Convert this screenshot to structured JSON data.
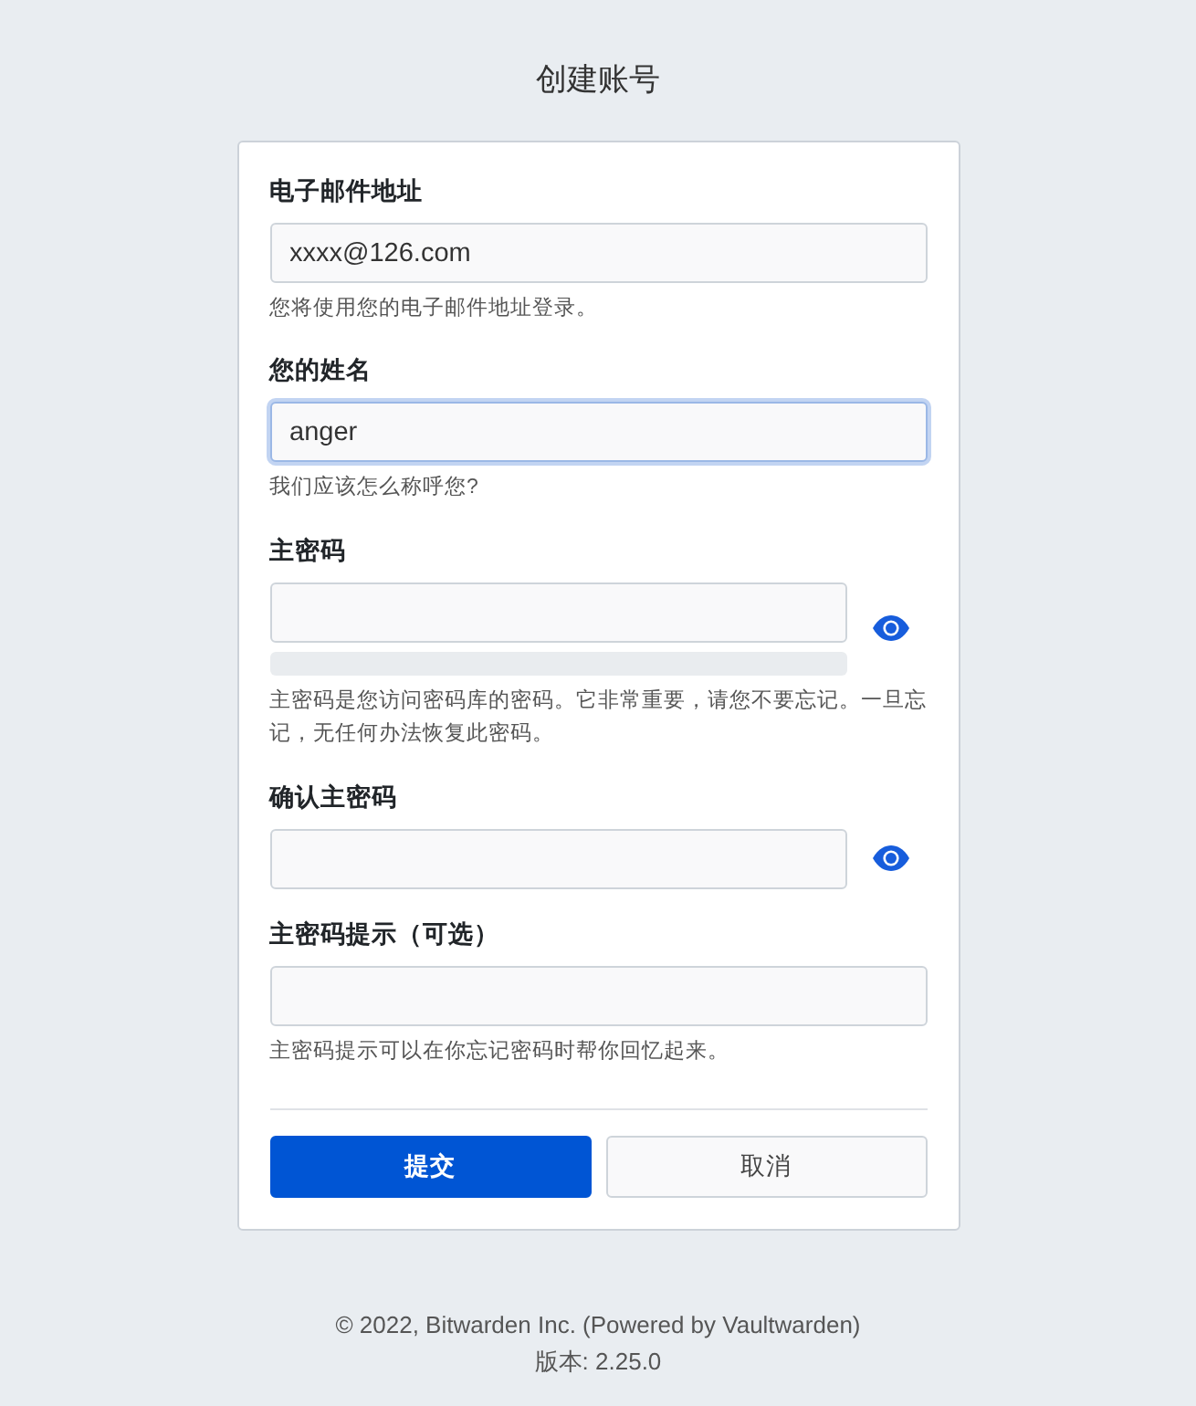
{
  "title": "创建账号",
  "fields": [
    {
      "kind": "text",
      "label": "电子邮件地址",
      "value": "xxxx@126.com",
      "focused": false,
      "help": "您将使用您的电子邮件地址登录。"
    },
    {
      "kind": "text",
      "label": "您的姓名",
      "value": "anger",
      "focused": true,
      "help": "我们应该怎么称呼您?"
    },
    {
      "kind": "password",
      "label": "主密码",
      "focused": false,
      "strength": {
        "level": 0
      },
      "help": "主密码是您访问密码库的密码。它非常重要，请您不要忘记。一旦忘记，无任何办法恢复此密码。"
    },
    {
      "kind": "password",
      "label": "确认主密码",
      "focused": false
    },
    {
      "kind": "text",
      "label": "主密码提示（可选）",
      "focused": false,
      "help": "主密码提示可以在你忘记密码时帮你回忆起来。"
    }
  ],
  "buttons": [
    {
      "kind": "primary",
      "label": "提交"
    },
    {
      "kind": "secondary",
      "label": "取消"
    }
  ],
  "footer": [
    "© 2022, Bitwarden Inc. (Powered by Vaultwarden)",
    "版本: 2.25.0"
  ]
}
